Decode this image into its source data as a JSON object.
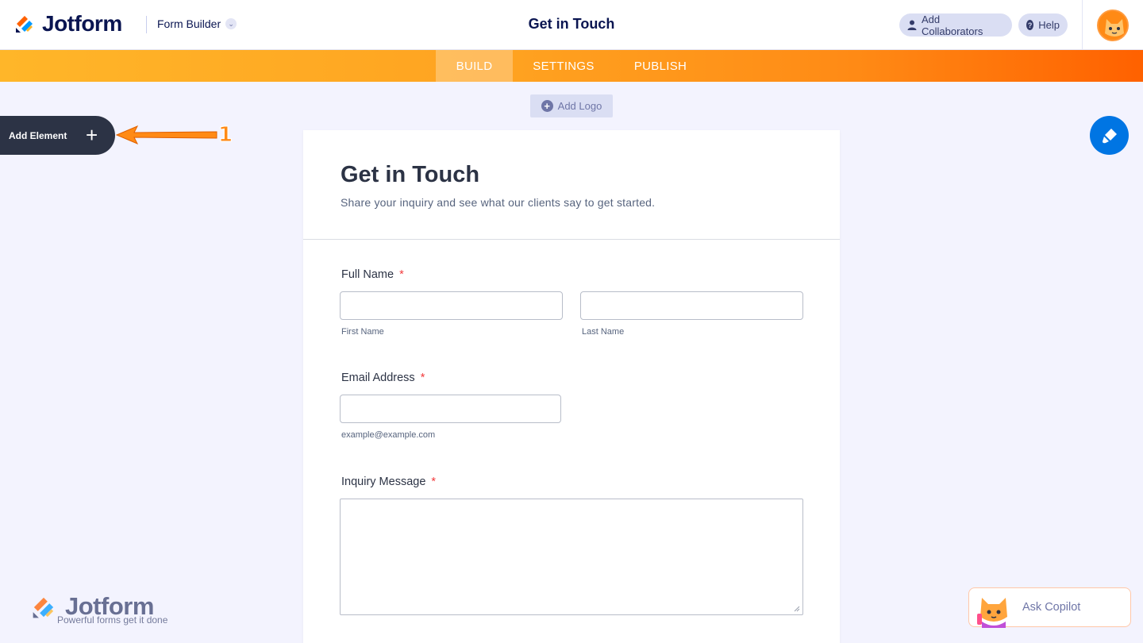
{
  "header": {
    "brand": "Jotform",
    "builder_label": "Form Builder",
    "page_title": "Get in Touch",
    "collaborators_label": "Add Collaborators",
    "help_label": "Help"
  },
  "nav": {
    "tabs": [
      {
        "label": "BUILD",
        "active": true
      },
      {
        "label": "SETTINGS",
        "active": false
      },
      {
        "label": "PUBLISH",
        "active": false
      }
    ]
  },
  "toolbar": {
    "add_logo_label": "Add Logo",
    "add_element_label": "Add Element",
    "annotation_number": "1"
  },
  "form": {
    "title": "Get in Touch",
    "subtitle": "Share your inquiry and see what our clients say to get started.",
    "fields": {
      "full_name": {
        "label": "Full Name",
        "required_mark": "*",
        "first_sublabel": "First Name",
        "last_sublabel": "Last Name",
        "first_value": "",
        "last_value": ""
      },
      "email": {
        "label": "Email Address",
        "required_mark": "*",
        "sublabel": "example@example.com",
        "value": ""
      },
      "message": {
        "label": "Inquiry Message",
        "required_mark": "*",
        "value": ""
      }
    }
  },
  "footer": {
    "brand": "Jotform",
    "tagline": "Powerful forms get it done",
    "copilot_label": "Ask Copilot"
  },
  "colors": {
    "accent_orange": "#ff6100",
    "navy": "#0a1551",
    "designer_blue": "#0075e3",
    "required_red": "#f23a3c"
  },
  "icons": [
    "jotform-logo-icon",
    "chevron-down-icon",
    "user-icon",
    "help-icon",
    "avatar-icon",
    "plus-icon",
    "paint-brush-icon",
    "copilot-cat-icon"
  ]
}
